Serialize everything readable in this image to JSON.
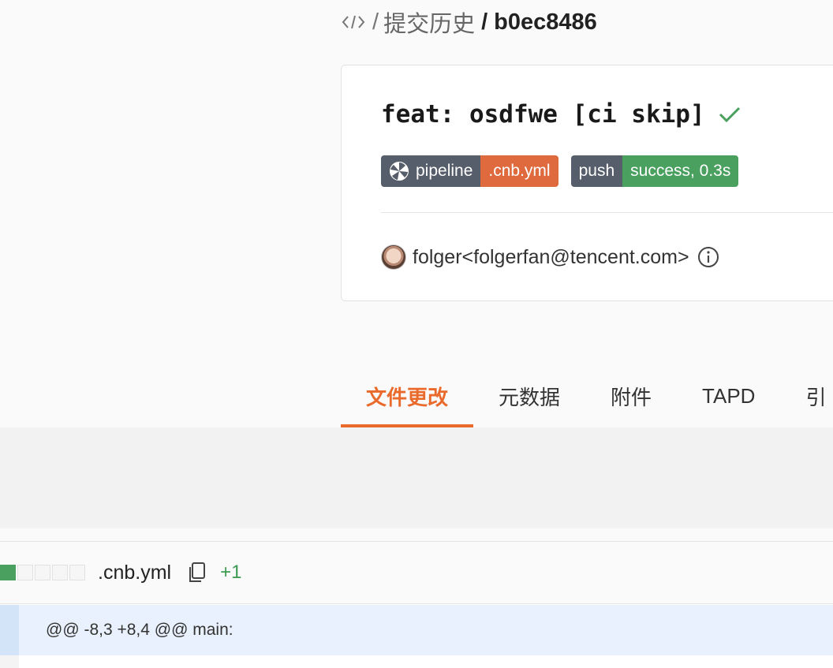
{
  "breadcrumb": {
    "code_icon": "code-icon",
    "separator": "/",
    "history_label": "提交历史",
    "commit_hash": "b0ec8486"
  },
  "commit": {
    "title": "feat: osdfwe [ci skip]",
    "status_icon": "check-icon",
    "badges": [
      {
        "left": "pipeline",
        "right": ".cnb.yml",
        "icon": "pipeline-icon",
        "right_color": "#de6a3e"
      },
      {
        "left": "push",
        "right": "success, 0.3s",
        "right_color": "#4aa05f"
      }
    ],
    "author": "folger<folgerfan@tencent.com>",
    "author_info_icon": "info-icon"
  },
  "tabs": [
    {
      "label": "文件更改",
      "active": true
    },
    {
      "label": "元数据",
      "active": false
    },
    {
      "label": "附件",
      "active": false
    },
    {
      "label": "TAPD",
      "active": false
    },
    {
      "label": "引",
      "active": false
    }
  ],
  "file": {
    "name": ".cnb.yml",
    "additions": "+1",
    "copy_icon": "copy-icon",
    "hunk_header": "@@ -8,3 +8,4 @@ main:"
  },
  "colors": {
    "accent": "#e96a2b",
    "success": "#4aa05f",
    "badge_dark": "#575e6b"
  }
}
